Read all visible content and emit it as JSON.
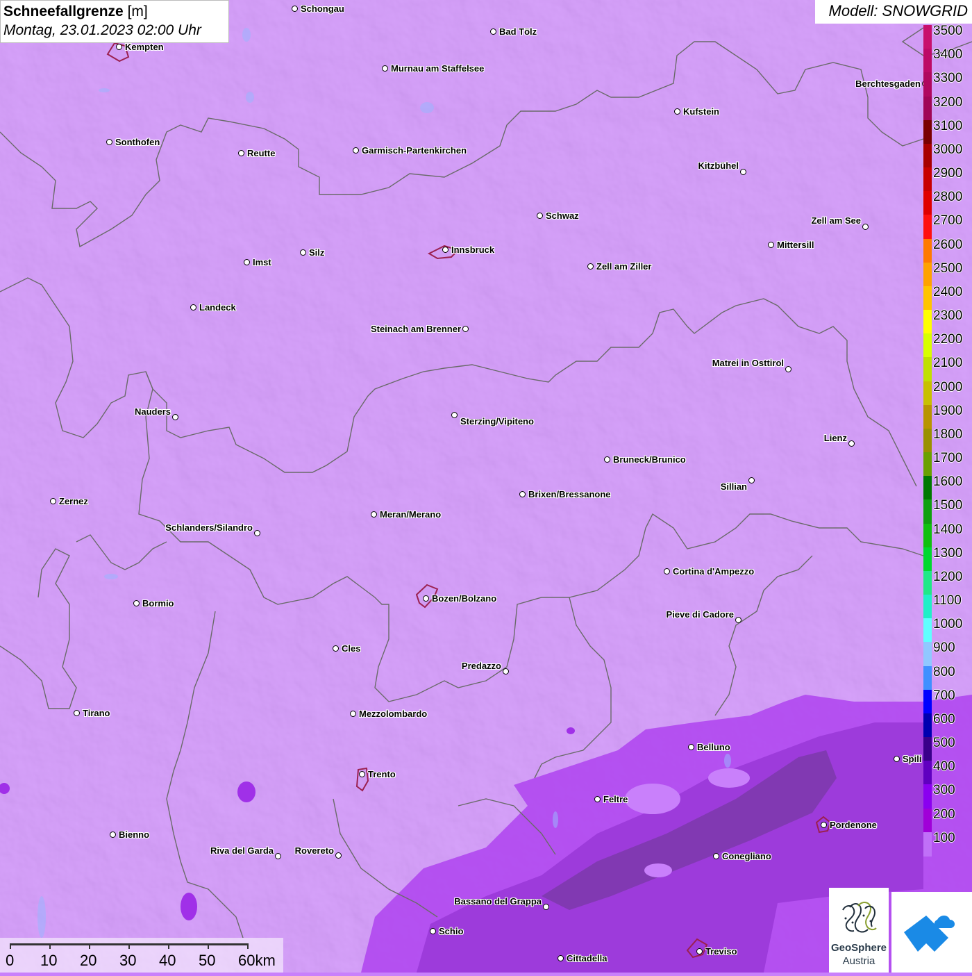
{
  "title": {
    "main": "Schneefallgrenze",
    "unit": "[m]",
    "datetime": "Montag, 23.01.2023 02:00 Uhr"
  },
  "model": "Modell: SNOWGRID",
  "colors": {
    "background_field": "#c980fb",
    "low_field": "#a030e8",
    "lowest_field": "#7a3aa8",
    "border_line": "#6a6a6a",
    "urban_outline": "#9b2050"
  },
  "cities": [
    {
      "name": "Schongau",
      "label_side": "right"
    },
    {
      "name": "Bad Tölz",
      "label_side": "right"
    },
    {
      "name": "Kempten",
      "label_side": "right"
    },
    {
      "name": "Murnau am Staffelsee",
      "label_side": "right"
    },
    {
      "name": "Berchtesgaden",
      "label_side": "left"
    },
    {
      "name": "Kufstein",
      "label_side": "right"
    },
    {
      "name": "Sonthofen",
      "label_side": "right"
    },
    {
      "name": "Reutte",
      "label_side": "right"
    },
    {
      "name": "Garmisch-Partenkirchen",
      "label_side": "right"
    },
    {
      "name": "Kitzbühel",
      "label_side": "left"
    },
    {
      "name": "Schwaz",
      "label_side": "right"
    },
    {
      "name": "Zell am See",
      "label_side": "left"
    },
    {
      "name": "Innsbruck",
      "label_side": "right"
    },
    {
      "name": "Mittersill",
      "label_side": "right"
    },
    {
      "name": "Silz",
      "label_side": "right"
    },
    {
      "name": "Imst",
      "label_side": "right"
    },
    {
      "name": "Zell am Ziller",
      "label_side": "right"
    },
    {
      "name": "Landeck",
      "label_side": "right"
    },
    {
      "name": "Steinach am Brenner",
      "label_side": "left"
    },
    {
      "name": "Matrei in Osttirol",
      "label_side": "left"
    },
    {
      "name": "Nauders",
      "label_side": "left"
    },
    {
      "name": "Sterzing/Vipiteno",
      "label_side": "right"
    },
    {
      "name": "Lienz",
      "label_side": "left"
    },
    {
      "name": "Bruneck/Brunico",
      "label_side": "right"
    },
    {
      "name": "Sillian",
      "label_side": "left"
    },
    {
      "name": "Zernez",
      "label_side": "right"
    },
    {
      "name": "Brixen/Bressanone",
      "label_side": "right"
    },
    {
      "name": "Meran/Merano",
      "label_side": "right"
    },
    {
      "name": "Schlanders/Silandro",
      "label_side": "left"
    },
    {
      "name": "Cortina d'Ampezzo",
      "label_side": "right"
    },
    {
      "name": "Bozen/Bolzano",
      "label_side": "right"
    },
    {
      "name": "Bormio",
      "label_side": "right"
    },
    {
      "name": "Pieve di Cadore",
      "label_side": "left"
    },
    {
      "name": "Cles",
      "label_side": "right"
    },
    {
      "name": "Predazzo",
      "label_side": "left"
    },
    {
      "name": "Tirano",
      "label_side": "right"
    },
    {
      "name": "Mezzolombardo",
      "label_side": "right"
    },
    {
      "name": "Belluno",
      "label_side": "right"
    },
    {
      "name": "Spili",
      "label_side": "right"
    },
    {
      "name": "Trento",
      "label_side": "right"
    },
    {
      "name": "Feltre",
      "label_side": "right"
    },
    {
      "name": "Pordenone",
      "label_side": "right"
    },
    {
      "name": "Bienno",
      "label_side": "right"
    },
    {
      "name": "Riva del Garda",
      "label_side": "left"
    },
    {
      "name": "Rovereto",
      "label_side": "left"
    },
    {
      "name": "Conegliano",
      "label_side": "right"
    },
    {
      "name": "Bassano del Grappa",
      "label_side": "left"
    },
    {
      "name": "Schio",
      "label_side": "right"
    },
    {
      "name": "Treviso",
      "label_side": "right"
    },
    {
      "name": "Cittadella",
      "label_side": "right"
    }
  ],
  "legend": {
    "labels": [
      "3500",
      "3400",
      "3300",
      "3200",
      "3100",
      "3000",
      "2900",
      "2800",
      "2700",
      "2600",
      "2500",
      "2400",
      "2300",
      "2200",
      "2100",
      "2000",
      "1900",
      "1800",
      "1700",
      "1600",
      "1500",
      "1400",
      "1300",
      "1200",
      "1100",
      "1000",
      "900",
      "800",
      "700",
      "600",
      "500",
      "400",
      "300",
      "200",
      "100"
    ],
    "colors": [
      "#c8106c",
      "#bd0a66",
      "#b0085e",
      "#a00656",
      "#7a0000",
      "#a80000",
      "#c80000",
      "#e00000",
      "#ff1010",
      "#ff7a00",
      "#ffa200",
      "#ffc400",
      "#ffff00",
      "#d8ff00",
      "#c0e000",
      "#c8c000",
      "#b89400",
      "#9a9000",
      "#6aa000",
      "#007800",
      "#10a010",
      "#10c010",
      "#00d830",
      "#20e888",
      "#20f0c8",
      "#60ffff",
      "#90c8ff",
      "#4090ff",
      "#0000ff",
      "#0000b0",
      "#3a008a",
      "#6000c0",
      "#8a00f0",
      "#a000d8",
      "#c070f8"
    ]
  },
  "scalebar": {
    "labels": [
      "0",
      "10",
      "20",
      "30",
      "40",
      "50",
      "60km"
    ]
  },
  "logos": {
    "geosphere_line1": "GeoSphere",
    "geosphere_line2": "Austria"
  }
}
